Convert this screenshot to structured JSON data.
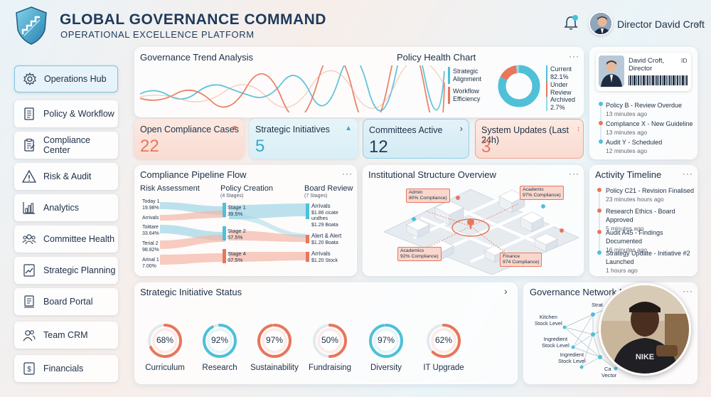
{
  "header": {
    "title": "GLOBAL GOVERNANCE COMMAND",
    "subtitle": "OPERATIONAL EXCELLENCE PLATFORM",
    "user_name": "Director David Croft",
    "icons": [
      "shield-logo",
      "bell-icon",
      "chevron-down-icon"
    ]
  },
  "sidebar": {
    "items": [
      {
        "label": "Operations Hub",
        "icon": "gear-icon",
        "active": true
      },
      {
        "label": "Policy & Workflow",
        "icon": "document-icon"
      },
      {
        "label": "Compliance Center",
        "icon": "clipboard-icon"
      },
      {
        "label": "Risk & Audit",
        "icon": "warning-icon"
      },
      {
        "label": "Analytics",
        "icon": "bar-chart-icon"
      },
      {
        "label": "Committee Health",
        "icon": "people-icon"
      },
      {
        "label": "Strategic Planning",
        "icon": "chart-doc-icon"
      },
      {
        "label": "Board Portal",
        "icon": "board-icon"
      },
      {
        "label": "Team CRM",
        "icon": "team-icon"
      },
      {
        "label": "Financials",
        "icon": "dollar-icon"
      }
    ]
  },
  "trend": {
    "title": "Governance Trend Analysis",
    "policy_title": "Policy Health Chart",
    "legend": [
      "Strategic Alignment",
      "Workflow Efficiency"
    ],
    "donut": [
      {
        "label": "Current",
        "value": "82.1%"
      },
      {
        "label": "Under Review",
        "value": ""
      },
      {
        "label": "Archived",
        "value": "2.7%"
      }
    ],
    "more": "···"
  },
  "kpis": [
    {
      "label": "Open Compliance Cases",
      "value": "22",
      "arrow": "▼"
    },
    {
      "label": "Strategic Initiatives",
      "value": "5",
      "arrow": "▲"
    },
    {
      "label": "Committees Active",
      "value": "12",
      "arrow": "›"
    },
    {
      "label": "System Updates (Last 24h)",
      "value": "3",
      "arrow": "↕"
    }
  ],
  "id_card": {
    "name": "David Croft,",
    "role": "Director",
    "id_label": "ID"
  },
  "notifications": [
    {
      "text": "Policy B - Review Overdue",
      "time": "13 minutes ago"
    },
    {
      "text": "Compliance X - New Guideline",
      "time": "13 minutes ago"
    },
    {
      "text": "Audit Y - Scheduled",
      "time": "12 minutes ago"
    }
  ],
  "pipeline": {
    "title": "Compliance Pipeline Flow",
    "col1": "Risk Assessment",
    "col2": "Policy Creation",
    "col2_sub": "(4 Stages)",
    "col3": "Board Review",
    "col3_sub": "(7 Stages)",
    "left_items": [
      {
        "name": "Today 1",
        "value": "19.98%"
      },
      {
        "name": "Arrivals",
        "value": ""
      },
      {
        "name": "Toittare",
        "value": "33.64%"
      },
      {
        "name": "Terial 2",
        "value": "98.82%"
      },
      {
        "name": "Arinal 1",
        "value": "7.00%"
      }
    ],
    "stages": [
      {
        "name": "Stage 1",
        "value": "39.5%"
      },
      {
        "name": "Stage 2",
        "value": "57.5%"
      },
      {
        "name": "Stage 4",
        "value": "67.5%"
      }
    ],
    "right_items": [
      {
        "name": "Arrivals",
        "l1": "$1.86 cicate",
        "l2": "undhes",
        "l3": "$1.29 Boata"
      },
      {
        "name": "Alert & Alert",
        "l1": "$1.20 Boata",
        "l2": "",
        "l3": ""
      },
      {
        "name": "Arrivals",
        "l1": "$1.20 Stock",
        "l2": "",
        "l3": ""
      }
    ]
  },
  "structure": {
    "title": "Institutional Structure Overview",
    "labels": [
      {
        "name": "Admin",
        "sub": "80% Compliance)"
      },
      {
        "name": "Academic",
        "sub": "97% Compliance)"
      },
      {
        "name": "Academics",
        "sub": "92% Compliance)"
      },
      {
        "name": "Finance",
        "sub": "974 Compliance)"
      }
    ]
  },
  "activity": {
    "title": "Activity Timeline",
    "items": [
      {
        "text": "Policy C21 - Revision Finalised",
        "time": "23 minutes hours ago"
      },
      {
        "text": "Research Ethics - Board Approved",
        "time": "5 minutes ago"
      },
      {
        "text": "Audit A45 - Findings Documented",
        "time": "16 minutes ago"
      },
      {
        "text": "Strategy Update - Initiative #2 Launched",
        "time": "1 hours ago"
      }
    ]
  },
  "initiatives": {
    "title": "Strategic Initiative Status",
    "chevron": "›",
    "rings": [
      {
        "label": "Curriculum",
        "pct": 68,
        "value": "68%",
        "color": "#e8765c"
      },
      {
        "label": "Research",
        "pct": 92,
        "value": "92%",
        "color": "#4fc0d8"
      },
      {
        "label": "Sustainability",
        "pct": 97,
        "value": "97%",
        "color": "#e8765c"
      },
      {
        "label": "Fundraising",
        "pct": 50,
        "value": "50%",
        "color": "#e8765c"
      },
      {
        "label": "Diversity",
        "pct": 97,
        "value": "97%",
        "color": "#4fc0d8"
      },
      {
        "label": "IT Upgrade",
        "pct": 62,
        "value": "62%",
        "color": "#e8765c"
      }
    ]
  },
  "network": {
    "title": "Governance Network M",
    "nodes": [
      {
        "l1": "Kitchen",
        "l2": "Stock Level"
      },
      {
        "l1": "Ingredient",
        "l2": "Stock Level"
      },
      {
        "l1": "Ingredient",
        "l2": "Stock Level"
      },
      {
        "l1": "Strat",
        "l2": ""
      },
      {
        "l1": "Ca",
        "l2": ""
      },
      {
        "l1": "Vector",
        "l2": ""
      }
    ],
    "more": "···"
  },
  "colors": {
    "accent_orange": "#e8765c",
    "accent_blue": "#4fc0d8",
    "navy": "#1f3a5a"
  }
}
